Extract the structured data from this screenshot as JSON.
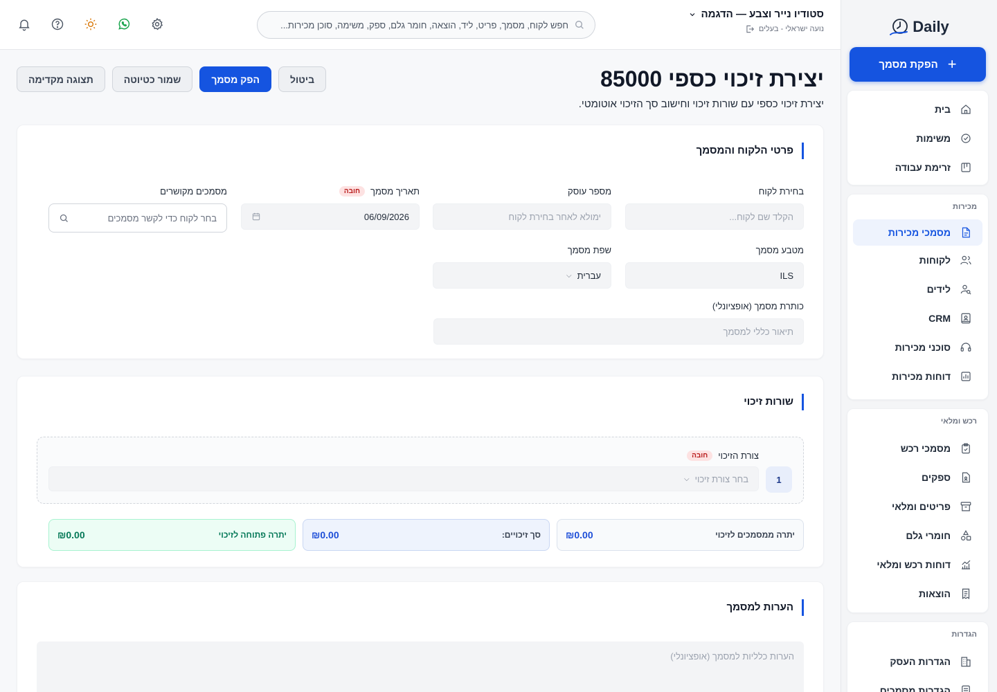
{
  "sidebar": {
    "logo_text": "Daily",
    "new_doc_label": "הפקת מסמך",
    "group_main": [
      {
        "label": "בית",
        "icon": "home-icon"
      },
      {
        "label": "משימות",
        "icon": "check-circle-icon"
      },
      {
        "label": "זרימת עבודה",
        "icon": "kanban-icon"
      }
    ],
    "sales_title": "מכירות",
    "sales_items": [
      {
        "label": "מסמכי מכירות",
        "icon": "document-icon",
        "active": true
      },
      {
        "label": "לקוחות",
        "icon": "users-icon"
      },
      {
        "label": "לידים",
        "icon": "lead-search-icon"
      },
      {
        "label": "CRM",
        "icon": "contact-card-icon"
      },
      {
        "label": "סוכני מכירות",
        "icon": "headset-icon"
      },
      {
        "label": "דוחות מכירות",
        "icon": "bar-chart-icon"
      }
    ],
    "purchase_title": "רכש ומלאי",
    "purchase_items": [
      {
        "label": "מסמכי רכש",
        "icon": "clipboard-icon"
      },
      {
        "label": "ספקים",
        "icon": "supplier-icon"
      },
      {
        "label": "פריטים ומלאי",
        "icon": "archive-icon"
      },
      {
        "label": "חומרי גלם",
        "icon": "shapes-icon"
      },
      {
        "label": "דוחות רכש ומלאי",
        "icon": "line-chart-icon"
      },
      {
        "label": "הוצאות",
        "icon": "receipt-icon"
      }
    ],
    "settings_title": "הגדרות",
    "settings_items": [
      {
        "label": "הגדרות העסק",
        "icon": "building-icon"
      },
      {
        "label": "הגדרות מסמכים",
        "icon": "doc-settings-icon"
      }
    ]
  },
  "topbar": {
    "business_name": "סטודיו נייר וצבע — הדגמה",
    "user_line": "נועה ישראלי - בעלים",
    "search_placeholder": "חפש לקוח, מסמך, פריט, ליד, הוצאה, חומר גלם, ספק, משימה, סוכן מכירות..."
  },
  "page": {
    "title": "יצירת זיכוי כספי 85000",
    "subtitle": "יצירת זיכוי כספי עם שורות זיכוי וחישוב סך הזיכוי אוטומטי.",
    "actions": {
      "cancel": "ביטול",
      "issue": "הפק מסמך",
      "save_draft": "שמור כטיוטה",
      "preview": "תצוגה מקדימה"
    }
  },
  "customer_card": {
    "title": "פרטי הלקוח והמסמך",
    "required_badge": "חובה",
    "customer_label": "בחירת לקוח",
    "customer_placeholder": "הקלד שם לקוח...",
    "business_id_label": "מספר עוסק",
    "business_id_placeholder": "ימולא לאחר בחירת לקוח",
    "doc_date_label": "תאריך מסמך",
    "doc_date_value": "06/09/2026",
    "related_label": "מסמכים מקושרים",
    "related_placeholder": "בחר לקוח כדי לקשר מסמכים",
    "currency_label": "מטבע מסמך",
    "currency_value": "ILS",
    "language_label": "שפת מסמך",
    "language_value": "עברית",
    "doc_title_label": "כותרת מסמך (אופציונלי)",
    "doc_title_placeholder": "תיאור כללי למסמך"
  },
  "lines_card": {
    "title": "שורות זיכוי",
    "line_number": "1",
    "method_label": "צורת הזיכוי",
    "required_badge": "חובה",
    "method_placeholder": "בחר צורת זיכוי",
    "balance_label": "יתרה ממסמכים לזיכוי",
    "balance_value": "₪0.00",
    "total_label": "סך זיכויים:",
    "total_value": "₪0.00",
    "open_label": "יתרה פתוחה לזיכוי",
    "open_value": "₪0.00"
  },
  "notes_card": {
    "title": "הערות למסמך",
    "placeholder": "הערות כלליות למסמך (אופציונלי)"
  },
  "colors": {
    "primary": "#1554e0",
    "success": "#047857",
    "danger": "#b91c1c"
  }
}
